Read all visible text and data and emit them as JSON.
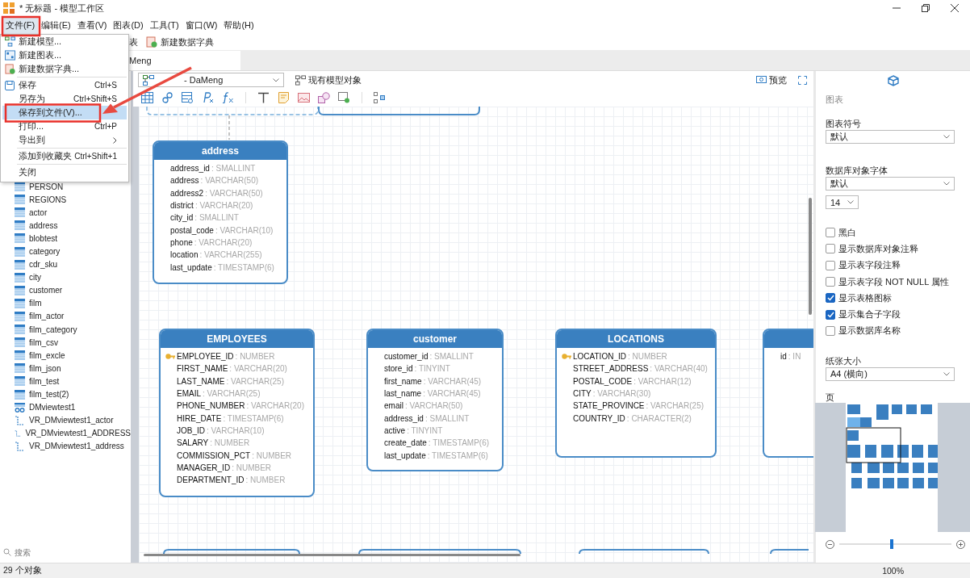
{
  "window": {
    "title": "* 无标题 - 模型工作区"
  },
  "menu_bar": [
    {
      "label": "文件(F)",
      "selected": true
    },
    {
      "label": "编辑(E)",
      "selected": false
    },
    {
      "label": "查看(V)",
      "selected": false
    },
    {
      "label": "图表(D)",
      "selected": false
    },
    {
      "label": "工具(T)",
      "selected": false
    },
    {
      "label": "窗口(W)",
      "selected": false
    },
    {
      "label": "帮助(H)",
      "selected": false
    }
  ],
  "toolbar": [
    {
      "label": "表"
    },
    {
      "label": "新建数据字典"
    }
  ],
  "file_menu": [
    {
      "kind": "item",
      "label": "新建模型...",
      "selected": false
    },
    {
      "kind": "item",
      "label": "新建图表...",
      "selected": false
    },
    {
      "kind": "item",
      "label": "新建数据字典...",
      "selected": false
    },
    {
      "kind": "separator"
    },
    {
      "kind": "item",
      "label": "保存",
      "shortcut": "Ctrl+S",
      "selected": false
    },
    {
      "kind": "item",
      "label": "另存为",
      "shortcut": "Ctrl+Shift+S",
      "selected": false
    },
    {
      "kind": "item",
      "label": "保存到文件(V)...",
      "selected": true
    },
    {
      "kind": "item",
      "label": "打印...",
      "shortcut": "Ctrl+P",
      "selected": false
    },
    {
      "kind": "submenu",
      "label": "导出到",
      "selected": false
    },
    {
      "kind": "separator"
    },
    {
      "kind": "item",
      "label": "添加到收藏夹",
      "shortcut": "Ctrl+Shift+1",
      "selected": false
    },
    {
      "kind": "separator"
    },
    {
      "kind": "item",
      "label": "关闭",
      "selected": false
    }
  ],
  "tab": {
    "label": "Meng"
  },
  "sidebar": {
    "items": [
      {
        "kind": "table",
        "label": "PERSON"
      },
      {
        "kind": "table",
        "label": "REGIONS"
      },
      {
        "kind": "table",
        "label": "actor"
      },
      {
        "kind": "table",
        "label": "address"
      },
      {
        "kind": "table",
        "label": "blobtest"
      },
      {
        "kind": "table",
        "label": "category"
      },
      {
        "kind": "table",
        "label": "cdr_sku"
      },
      {
        "kind": "table",
        "label": "city"
      },
      {
        "kind": "table",
        "label": "customer"
      },
      {
        "kind": "table",
        "label": "film"
      },
      {
        "kind": "table",
        "label": "film_actor"
      },
      {
        "kind": "table",
        "label": "film_category"
      },
      {
        "kind": "table",
        "label": "film_csv"
      },
      {
        "kind": "table",
        "label": "film_excle"
      },
      {
        "kind": "table",
        "label": "film_json"
      },
      {
        "kind": "table",
        "label": "film_test"
      },
      {
        "kind": "table",
        "label": "film_test(2)"
      },
      {
        "kind": "view",
        "label": "DMviewtest1"
      },
      {
        "kind": "relation",
        "label": "VR_DMviewtest1_actor"
      },
      {
        "kind": "relation",
        "label": "VR_DMviewtest1_ADDRESS"
      },
      {
        "kind": "relation",
        "label": "VR_DMviewtest1_address"
      }
    ],
    "search": {
      "placeholder": "搜索"
    }
  },
  "canvas": {
    "model_select": {
      "value": "- DaMeng"
    },
    "existing_objects": "现有模型对象",
    "preview": "预览",
    "tables": [
      {
        "title": "address",
        "columns": [
          {
            "name": "address_id",
            "type": ": SMALLINT",
            "key": false
          },
          {
            "name": "address",
            "type": ": VARCHAR(50)",
            "key": false
          },
          {
            "name": "address2",
            "type": ": VARCHAR(50)",
            "key": false
          },
          {
            "name": "district",
            "type": ": VARCHAR(20)",
            "key": false
          },
          {
            "name": "city_id",
            "type": ": SMALLINT",
            "key": false
          },
          {
            "name": "postal_code",
            "type": ": VARCHAR(10)",
            "key": false
          },
          {
            "name": "phone",
            "type": ": VARCHAR(20)",
            "key": false
          },
          {
            "name": "location",
            "type": ": VARCHAR(255)",
            "key": false
          },
          {
            "name": "last_update",
            "type": ": TIMESTAMP(6)",
            "key": false
          }
        ]
      },
      {
        "title": "EMPLOYEES",
        "columns": [
          {
            "name": "EMPLOYEE_ID",
            "type": ": NUMBER",
            "key": true
          },
          {
            "name": "FIRST_NAME",
            "type": ": VARCHAR(20)",
            "key": false
          },
          {
            "name": "LAST_NAME",
            "type": ": VARCHAR(25)",
            "key": false
          },
          {
            "name": "EMAIL",
            "type": ": VARCHAR(25)",
            "key": false
          },
          {
            "name": "PHONE_NUMBER",
            "type": ": VARCHAR(20)",
            "key": false
          },
          {
            "name": "HIRE_DATE",
            "type": ": TIMESTAMP(6)",
            "key": false
          },
          {
            "name": "JOB_ID",
            "type": ": VARCHAR(10)",
            "key": false
          },
          {
            "name": "SALARY",
            "type": ": NUMBER",
            "key": false
          },
          {
            "name": "COMMISSION_PCT",
            "type": ": NUMBER",
            "key": false
          },
          {
            "name": "MANAGER_ID",
            "type": ": NUMBER",
            "key": false
          },
          {
            "name": "DEPARTMENT_ID",
            "type": ": NUMBER",
            "key": false
          }
        ]
      },
      {
        "title": "customer",
        "columns": [
          {
            "name": "customer_id",
            "type": ": SMALLINT",
            "key": false
          },
          {
            "name": "store_id",
            "type": ": TINYINT",
            "key": false
          },
          {
            "name": "first_name",
            "type": ": VARCHAR(45)",
            "key": false
          },
          {
            "name": "last_name",
            "type": ": VARCHAR(45)",
            "key": false
          },
          {
            "name": "email",
            "type": ": VARCHAR(50)",
            "key": false
          },
          {
            "name": "address_id",
            "type": ": SMALLINT",
            "key": false
          },
          {
            "name": "active",
            "type": ": TINYINT",
            "key": false
          },
          {
            "name": "create_date",
            "type": ": TIMESTAMP(6)",
            "key": false
          },
          {
            "name": "last_update",
            "type": ": TIMESTAMP(6)",
            "key": false
          }
        ]
      },
      {
        "title": "LOCATIONS",
        "columns": [
          {
            "name": "LOCATION_ID",
            "type": ": NUMBER",
            "key": true
          },
          {
            "name": "STREET_ADDRESS",
            "type": ": VARCHAR(40)",
            "key": false
          },
          {
            "name": "POSTAL_CODE",
            "type": ": VARCHAR(12)",
            "key": false
          },
          {
            "name": "CITY",
            "type": ": VARCHAR(30)",
            "key": false
          },
          {
            "name": "STATE_PROVINCE",
            "type": ": VARCHAR(25)",
            "key": false
          },
          {
            "name": "COUNTRY_ID",
            "type": ": CHARACTER(2)",
            "key": false
          }
        ]
      },
      {
        "columns": [
          {
            "name": "id",
            "type": ": IN",
            "key": false
          }
        ]
      }
    ]
  },
  "properties": {
    "heading": "图表",
    "notation": {
      "label": "图表符号",
      "value": "默认"
    },
    "font": {
      "label": "数据库对象字体",
      "value": "默认",
      "size": "14"
    },
    "options": [
      {
        "label": "黑白",
        "checked": false
      },
      {
        "label": "显示数据库对象注释",
        "checked": false
      },
      {
        "label": "显示表字段注释",
        "checked": false
      },
      {
        "label": "显示表字段 NOT NULL 属性",
        "checked": false
      },
      {
        "label": "显示表格图标",
        "checked": true
      },
      {
        "label": "显示集合子字段",
        "checked": true
      },
      {
        "label": "显示数据库名称",
        "checked": false
      }
    ],
    "paper": {
      "label": "纸张大小",
      "value": "A4 (横向)"
    },
    "page_label": "页",
    "zoom": {
      "level": 0.47
    }
  },
  "status_bar": {
    "objects": "29 个对象",
    "zoom": "100%"
  }
}
